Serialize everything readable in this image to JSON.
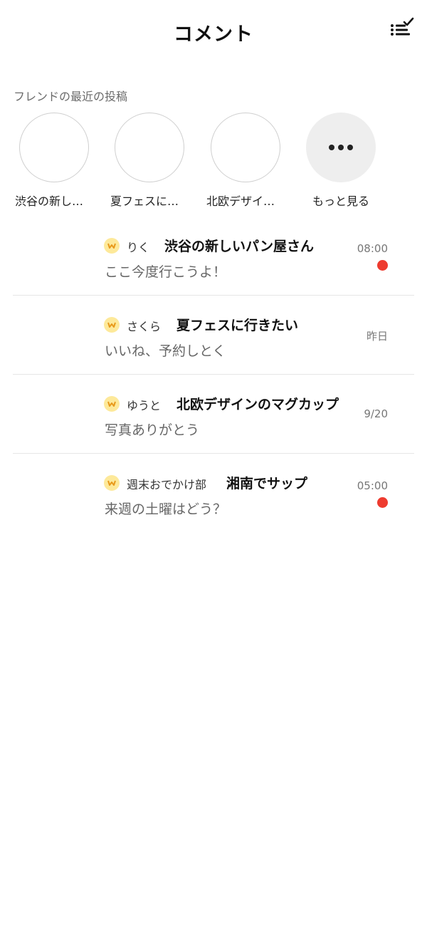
{
  "header": {
    "title": "コメント",
    "mark_all_read_icon": "list-check-icon"
  },
  "recent_posts": {
    "label": "フレンドの最近の投稿",
    "items": [
      {
        "label": "渋谷の新しいパン屋さん"
      },
      {
        "label": "夏フェスに行きたい"
      },
      {
        "label": "北欧デザインのマグカップ"
      }
    ],
    "more_label": "もっと見る",
    "more_icon": "more-dots-icon"
  },
  "comments": [
    {
      "user": "りく",
      "post": "渋谷の新しいパン屋さん",
      "comment": "ここ今度行こうよ！",
      "time": "08:00",
      "unread": true
    },
    {
      "user": "さくら",
      "post": "夏フェスに行きたい",
      "comment": "いいね、予約しとく",
      "time": "昨日",
      "unread": false
    },
    {
      "user": "ゆうと",
      "post": "北欧デザインのマグカップ",
      "comment": "写真ありがとう",
      "time": "9/20",
      "unread": false
    },
    {
      "user": "週末おでかけ部",
      "post": "湘南でサップ",
      "comment": "来週の土曜はどう？",
      "time": "05:00",
      "unread": true
    }
  ],
  "colors": {
    "unread_dot": "#ee3b2f",
    "user_badge": "#fde99a",
    "badge_glyph": "#e89a1c"
  }
}
